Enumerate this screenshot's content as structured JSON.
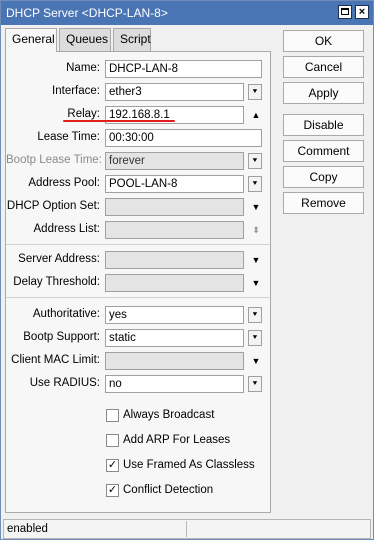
{
  "window": {
    "title": "DHCP Server <DHCP-LAN-8>",
    "maximize_icon": "maximize-icon",
    "close_glyph": "×"
  },
  "tabs": [
    {
      "label": "General",
      "active": true
    },
    {
      "label": "Queues",
      "active": false
    },
    {
      "label": "Script",
      "active": false
    }
  ],
  "form": {
    "name": {
      "label": "Name:",
      "value": "DHCP-LAN-8"
    },
    "interface": {
      "label": "Interface:",
      "value": "ether3"
    },
    "relay": {
      "label": "Relay:",
      "value": "192.168.8.1"
    },
    "lease_time": {
      "label": "Lease Time:",
      "value": "00:30:00"
    },
    "bootp_lease_time": {
      "label": "Bootp Lease Time:",
      "value": "forever"
    },
    "address_pool": {
      "label": "Address Pool:",
      "value": "POOL-LAN-8"
    },
    "dhcp_option_set": {
      "label": "DHCP Option Set:",
      "value": ""
    },
    "address_list": {
      "label": "Address List:",
      "value": ""
    },
    "server_address": {
      "label": "Server Address:",
      "value": ""
    },
    "delay_threshold": {
      "label": "Delay Threshold:",
      "value": ""
    },
    "authoritative": {
      "label": "Authoritative:",
      "value": "yes"
    },
    "bootp_support": {
      "label": "Bootp Support:",
      "value": "static"
    },
    "client_mac_limit": {
      "label": "Client MAC Limit:",
      "value": ""
    },
    "use_radius": {
      "label": "Use RADIUS:",
      "value": "no"
    }
  },
  "checkboxes": [
    {
      "label": "Always Broadcast",
      "checked": false
    },
    {
      "label": "Add ARP For Leases",
      "checked": false
    },
    {
      "label": "Use Framed As Classless",
      "checked": true
    },
    {
      "label": "Conflict Detection",
      "checked": true
    }
  ],
  "buttons": {
    "ok": "OK",
    "cancel": "Cancel",
    "apply": "Apply",
    "disable": "Disable",
    "comment": "Comment",
    "copy": "Copy",
    "remove": "Remove"
  },
  "status": {
    "text": "enabled",
    "secondary": ""
  },
  "glyphs": {
    "dropdown": "▼",
    "dropdown_box": "⯆",
    "up": "▲",
    "updown": "⬍",
    "check": "✓"
  },
  "colors": {
    "titlebar": "#4a75b5",
    "annotation_underline": "#e21f1f"
  }
}
